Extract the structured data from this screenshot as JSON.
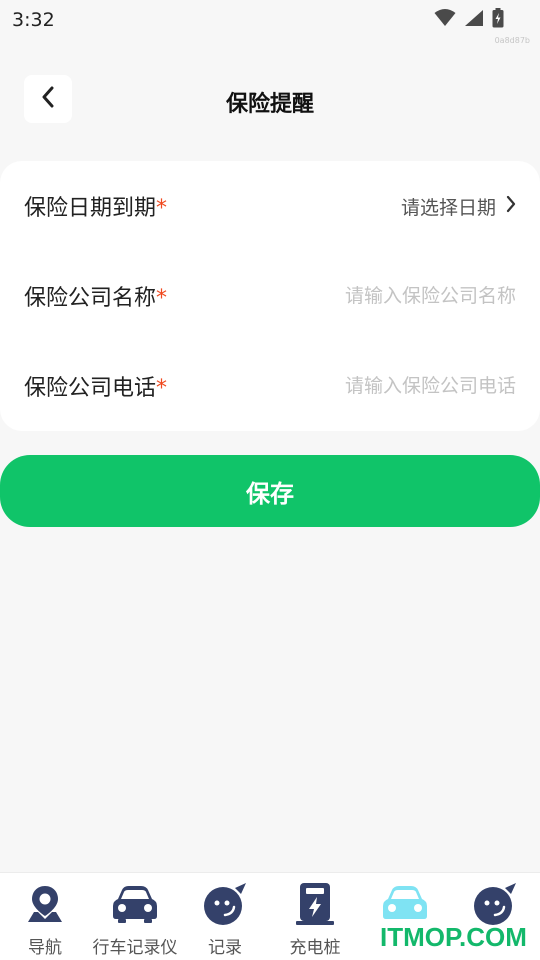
{
  "status_bar": {
    "time": "3:32",
    "icons": [
      "wifi-icon",
      "signal-icon",
      "battery-charging-icon"
    ],
    "build_tag": "0a8d87b"
  },
  "header": {
    "title": "保险提醒",
    "back_icon": "chevron-left-icon"
  },
  "form": {
    "rows": [
      {
        "label": "保险日期到期",
        "required": "*",
        "placeholder": "请选择日期",
        "type": "select"
      },
      {
        "label": "保险公司名称",
        "required": "*",
        "placeholder": "请输入保险公司名称",
        "type": "text"
      },
      {
        "label": "保险公司电话",
        "required": "*",
        "placeholder": "请输入保险公司电话",
        "type": "text"
      }
    ]
  },
  "save_label": "保存",
  "bottom_nav": {
    "items": [
      {
        "label": "导航",
        "icon": "map-pin-icon"
      },
      {
        "label": "行车记录仪",
        "icon": "car-icon"
      },
      {
        "label": "记录",
        "icon": "record-face-icon"
      },
      {
        "label": "充电桩",
        "icon": "charging-station-icon"
      },
      {
        "label": "",
        "icon": "car-icon-active"
      },
      {
        "label": "",
        "icon": "profile-face-icon"
      }
    ]
  },
  "watermark": "ITMOP.COM",
  "colors": {
    "accent": "#10c469",
    "required": "#f04a20",
    "nav_icon": "#34416a",
    "nav_icon_active": "#7fe3f3"
  }
}
